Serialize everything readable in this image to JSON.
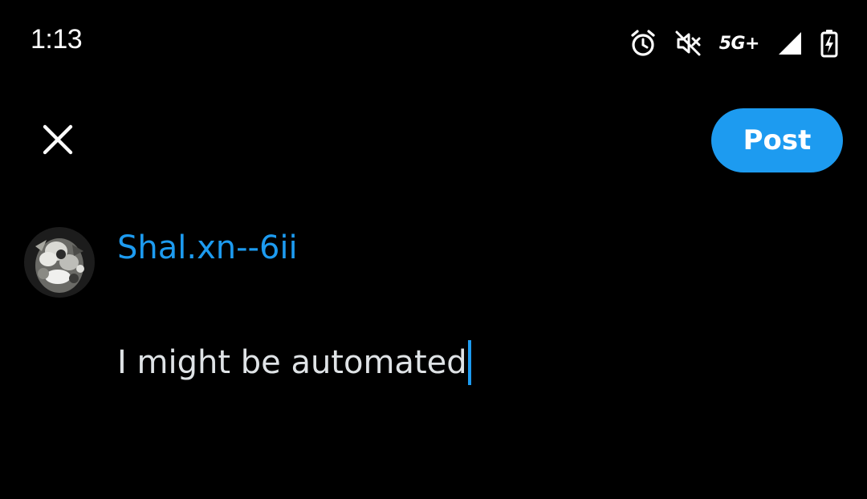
{
  "status_bar": {
    "time": "1:13",
    "network": "5G+",
    "icons": [
      "alarm-icon",
      "mute-icon",
      "network-5g-icon",
      "signal-icon",
      "battery-charging-icon"
    ]
  },
  "header": {
    "close_icon": "close-icon",
    "post_label": "Post"
  },
  "author": {
    "name": "Shal.xn--6ii",
    "avatar_icon": "avatar"
  },
  "compose": {
    "text": "I might be automated"
  },
  "colors": {
    "background": "#000000",
    "accent": "#1d9bf0",
    "text": "#e7e9ea",
    "status_text": "#ffffff"
  }
}
